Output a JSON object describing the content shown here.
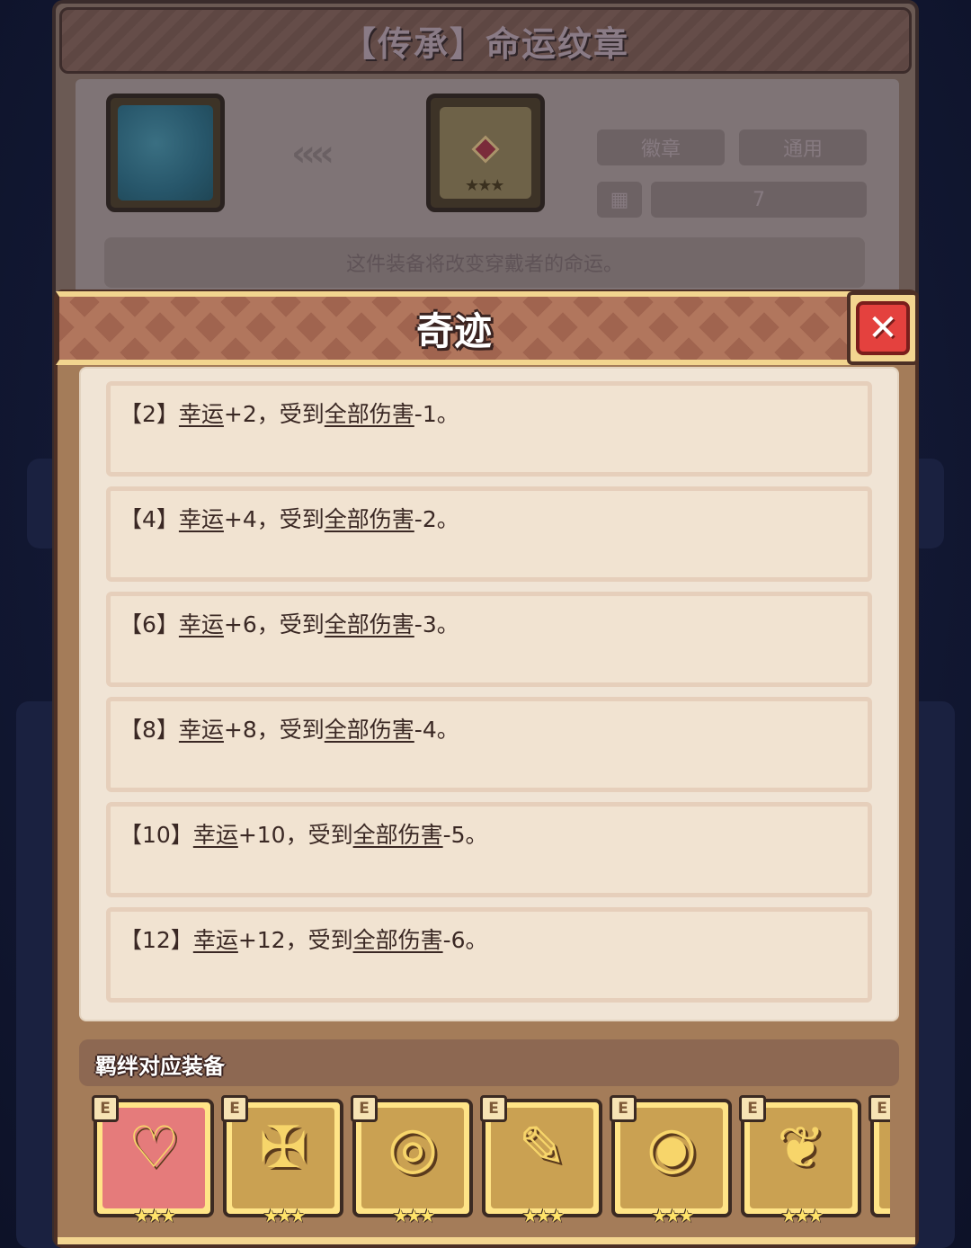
{
  "item": {
    "title": "【传承】命运纹章",
    "arrows": "‹‹‹‹",
    "tags": [
      "徽章",
      "通用"
    ],
    "count": "7",
    "description": "这件装备将改变穿戴者的命运。"
  },
  "popup": {
    "title": "奇迹",
    "close_glyph": "✕",
    "bonds": [
      {
        "tier": "【2】",
        "stat": "幸运",
        "stat_value": "+2，受到",
        "target": "全部伤害",
        "target_value": "-1。"
      },
      {
        "tier": "【4】",
        "stat": "幸运",
        "stat_value": "+4，受到",
        "target": "全部伤害",
        "target_value": "-2。"
      },
      {
        "tier": "【6】",
        "stat": "幸运",
        "stat_value": "+6，受到",
        "target": "全部伤害",
        "target_value": "-3。"
      },
      {
        "tier": "【8】",
        "stat": "幸运",
        "stat_value": "+8，受到",
        "target": "全部伤害",
        "target_value": "-4。"
      },
      {
        "tier": "【10】",
        "stat": "幸运",
        "stat_value": "+10，受到",
        "target": "全部伤害",
        "target_value": "-5。"
      },
      {
        "tier": "【12】",
        "stat": "幸运",
        "stat_value": "+12，受到",
        "target": "全部伤害",
        "target_value": "-6。"
      }
    ],
    "equip_title": "羁绊对应装备",
    "equipment": [
      {
        "tag": "E",
        "icon": "necklace-icon",
        "glyph": "♡",
        "stars": "★★★",
        "highlight": true
      },
      {
        "tag": "E",
        "icon": "armor-icon",
        "glyph": "✠",
        "stars": "★★★",
        "highlight": false
      },
      {
        "tag": "E",
        "icon": "ring-icon",
        "glyph": "◎",
        "stars": "★★★",
        "highlight": false
      },
      {
        "tag": "E",
        "icon": "scroll-icon",
        "glyph": "✎",
        "stars": "★★★",
        "highlight": false
      },
      {
        "tag": "E",
        "icon": "ring-gem-icon",
        "glyph": "◉",
        "stars": "★★★",
        "highlight": false
      },
      {
        "tag": "E",
        "icon": "amulet-icon",
        "glyph": "❦",
        "stars": "★★★",
        "highlight": false
      },
      {
        "tag": "E",
        "icon": "partial-item-icon",
        "glyph": "",
        "stars": "",
        "highlight": false
      }
    ]
  },
  "colors": {
    "popup_gold": "#f3d590",
    "close_red": "#e4413e",
    "panel_cream": "#f0e4d5",
    "text_dark": "#3a2824"
  }
}
